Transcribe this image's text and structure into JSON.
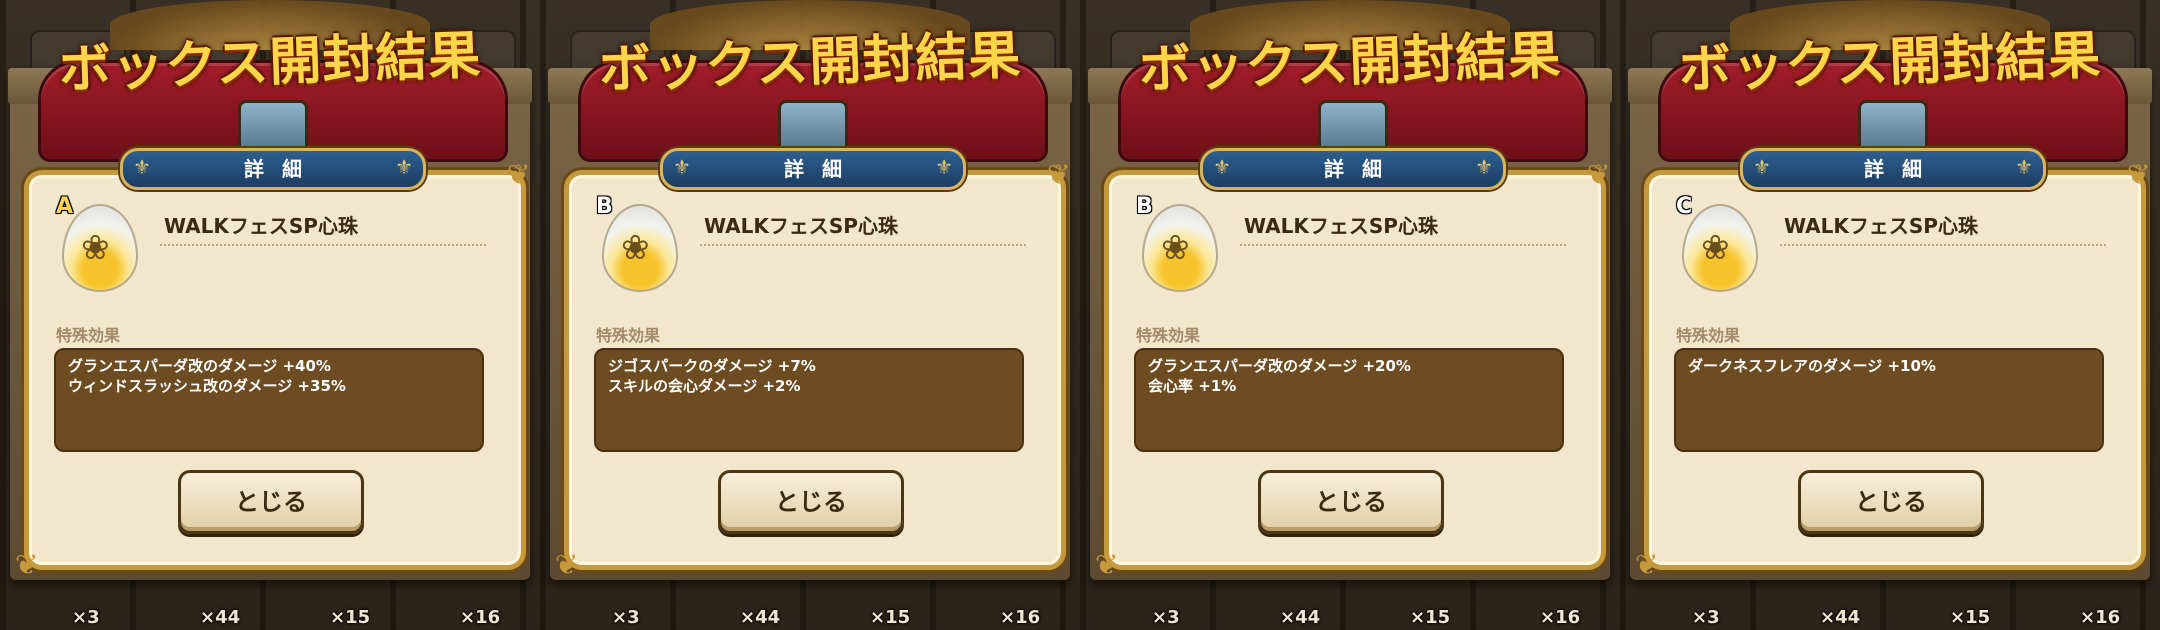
{
  "banner_title": "ボックス開封結果",
  "detail_tab_label": "詳細",
  "close_button_label": "とじる",
  "effect_section_label": "特殊効果",
  "background_counts": [
    "×3",
    "×44",
    "×15",
    "×16"
  ],
  "icons": {
    "gem": "heart-gem-icon",
    "wreath": "laurel-wreath-icon",
    "corner": "filigree-corner-icon",
    "fleur": "fleur-de-lis-icon",
    "chest": "treasure-chest-icon"
  },
  "colors": {
    "title_gold": "#ffd54a",
    "ribbon_red": "#a31d2a",
    "tab_blue": "#2d5f90",
    "dialog_cream": "#f2e6cc",
    "effect_brown": "#6e4c21"
  },
  "panels": [
    {
      "rank": "A",
      "item_name": "WALKフェスSP心珠",
      "effects": [
        "グランエスパーダ改のダメージ +40%",
        "ウィンドスラッシュ改のダメージ +35%"
      ]
    },
    {
      "rank": "B",
      "item_name": "WALKフェスSP心珠",
      "effects": [
        "ジゴスパークのダメージ +7%",
        "スキルの会心ダメージ +2%"
      ]
    },
    {
      "rank": "B",
      "item_name": "WALKフェスSP心珠",
      "effects": [
        "グランエスパーダ改のダメージ +20%",
        "会心率 +1%"
      ]
    },
    {
      "rank": "C",
      "item_name": "WALKフェスSP心珠",
      "effects": [
        "ダークネスフレアのダメージ +10%"
      ]
    }
  ]
}
